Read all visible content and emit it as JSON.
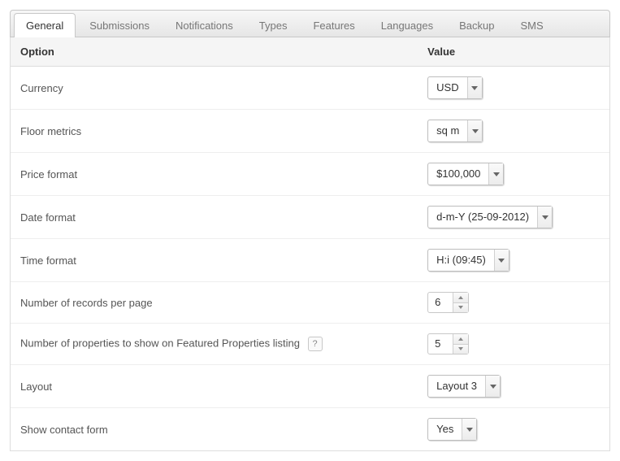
{
  "tabs": {
    "items": [
      {
        "label": "General",
        "active": true
      },
      {
        "label": "Submissions"
      },
      {
        "label": "Notifications"
      },
      {
        "label": "Types"
      },
      {
        "label": "Features"
      },
      {
        "label": "Languages"
      },
      {
        "label": "Backup"
      },
      {
        "label": "SMS"
      }
    ]
  },
  "table": {
    "headers": {
      "option": "Option",
      "value": "Value"
    },
    "rows": {
      "currency": {
        "label": "Currency",
        "value": "USD",
        "control": "select"
      },
      "floor_metrics": {
        "label": "Floor metrics",
        "value": "sq m",
        "control": "select"
      },
      "price_format": {
        "label": "Price format",
        "value": "$100,000",
        "control": "select"
      },
      "date_format": {
        "label": "Date format",
        "value": "d-m-Y (25-09-2012)",
        "control": "select"
      },
      "time_format": {
        "label": "Time format",
        "value": "H:i (09:45)",
        "control": "select"
      },
      "records_per_page": {
        "label": "Number of records per page",
        "value": "6",
        "control": "spinner"
      },
      "featured_count": {
        "label": "Number of properties to show on Featured Properties listing",
        "value": "5",
        "control": "spinner",
        "help": "?"
      },
      "layout": {
        "label": "Layout",
        "value": "Layout 3",
        "control": "select"
      },
      "show_contact": {
        "label": "Show contact form",
        "value": "Yes",
        "control": "select"
      }
    }
  }
}
